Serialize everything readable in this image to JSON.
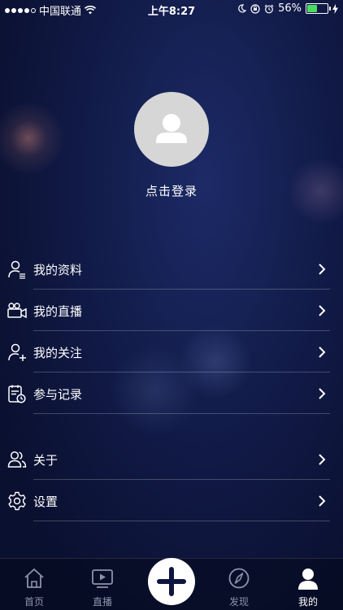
{
  "status_bar": {
    "carrier": "中国联通",
    "time": "上午8:27",
    "battery_percent_text": "56%",
    "battery_level": 0.56,
    "icons": [
      "signal-dots-icon",
      "wifi-icon",
      "moon-icon",
      "orientation-lock-icon",
      "alarm-icon",
      "battery-icon",
      "charging-icon"
    ]
  },
  "profile": {
    "avatar_icon": "default-user-avatar",
    "login_label": "点击登录"
  },
  "menu": {
    "items": [
      {
        "label": "我的资料",
        "icon": "profile-doc-icon"
      },
      {
        "label": "我的直播",
        "icon": "video-camera-icon"
      },
      {
        "label": "我的关注",
        "icon": "add-user-icon"
      },
      {
        "label": "参与记录",
        "icon": "record-clock-icon"
      }
    ],
    "items2": [
      {
        "label": "关于",
        "icon": "users-icon"
      },
      {
        "label": "设置",
        "icon": "gear-icon"
      }
    ]
  },
  "tab_bar": {
    "tabs": [
      {
        "label": "首页",
        "icon": "home-icon"
      },
      {
        "label": "直播",
        "icon": "play-tv-icon"
      },
      {
        "label": "发现",
        "icon": "compass-icon"
      },
      {
        "label": "我的",
        "icon": "user-icon"
      }
    ],
    "active_tab": "我的",
    "center_button_icon": "plus-icon"
  },
  "colors": {
    "background": "#111a46",
    "tab_inactive": "#8c93a8",
    "battery_fill": "#4cd964"
  }
}
